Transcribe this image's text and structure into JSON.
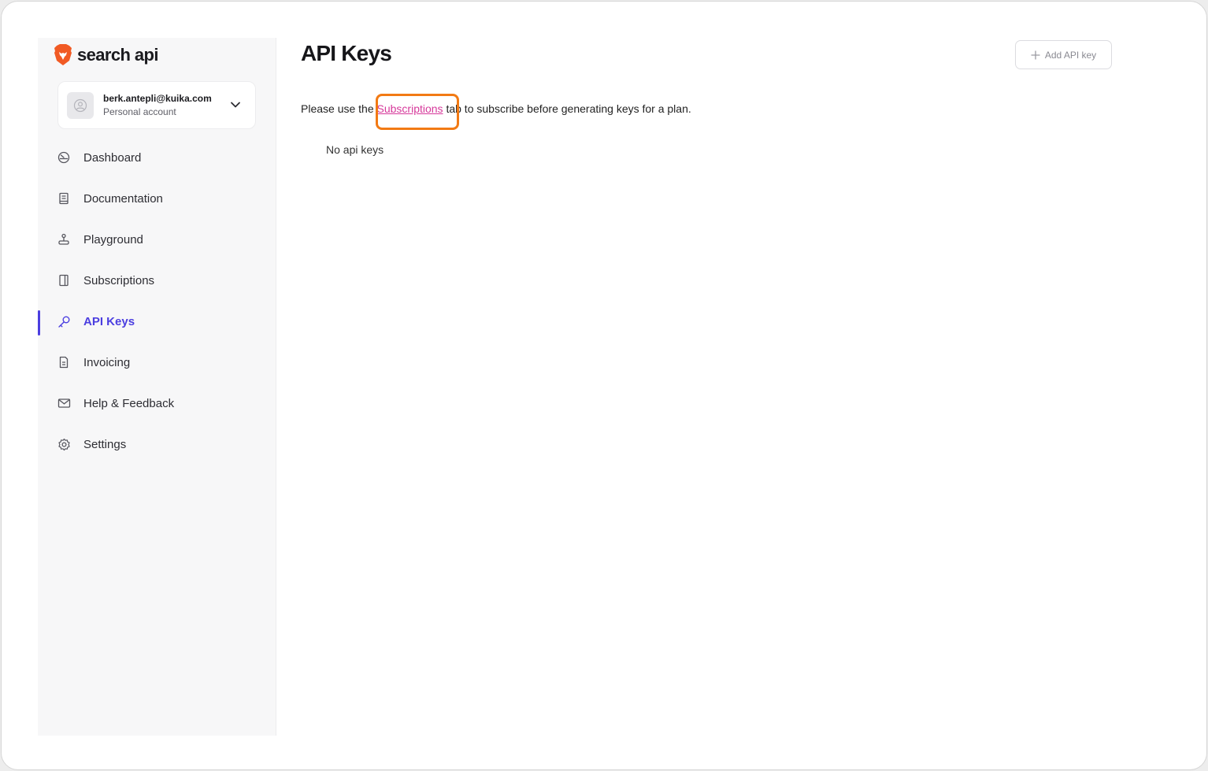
{
  "brand": {
    "name": "search api",
    "logo_icon": "brave-lion-icon",
    "color": "#f15a24"
  },
  "account": {
    "email": "berk.antepli@kuika.com",
    "type": "Personal account",
    "avatar_icon": "user-circle-icon",
    "toggle_icon": "chevron-down-icon"
  },
  "nav": {
    "items": [
      {
        "label": "Dashboard",
        "icon": "dashboard-icon",
        "active": false
      },
      {
        "label": "Documentation",
        "icon": "book-icon",
        "active": false
      },
      {
        "label": "Playground",
        "icon": "joystick-icon",
        "active": false
      },
      {
        "label": "Subscriptions",
        "icon": "subscriptions-icon",
        "active": false
      },
      {
        "label": "API Keys",
        "icon": "key-icon",
        "active": true
      },
      {
        "label": "Invoicing",
        "icon": "invoice-icon",
        "active": false
      },
      {
        "label": "Help & Feedback",
        "icon": "mail-icon",
        "active": false
      },
      {
        "label": "Settings",
        "icon": "gear-icon",
        "active": false
      }
    ]
  },
  "main": {
    "title": "API Keys",
    "add_button_label": "Add API key",
    "info_prefix": "Please use the ",
    "info_link": "Subscriptions",
    "info_suffix": " tab to subscribe before generating keys for a plan.",
    "empty_text": "No api keys"
  },
  "colors": {
    "accent": "#4b3ee0",
    "link": "#d6389a",
    "highlight": "#f27a14"
  }
}
